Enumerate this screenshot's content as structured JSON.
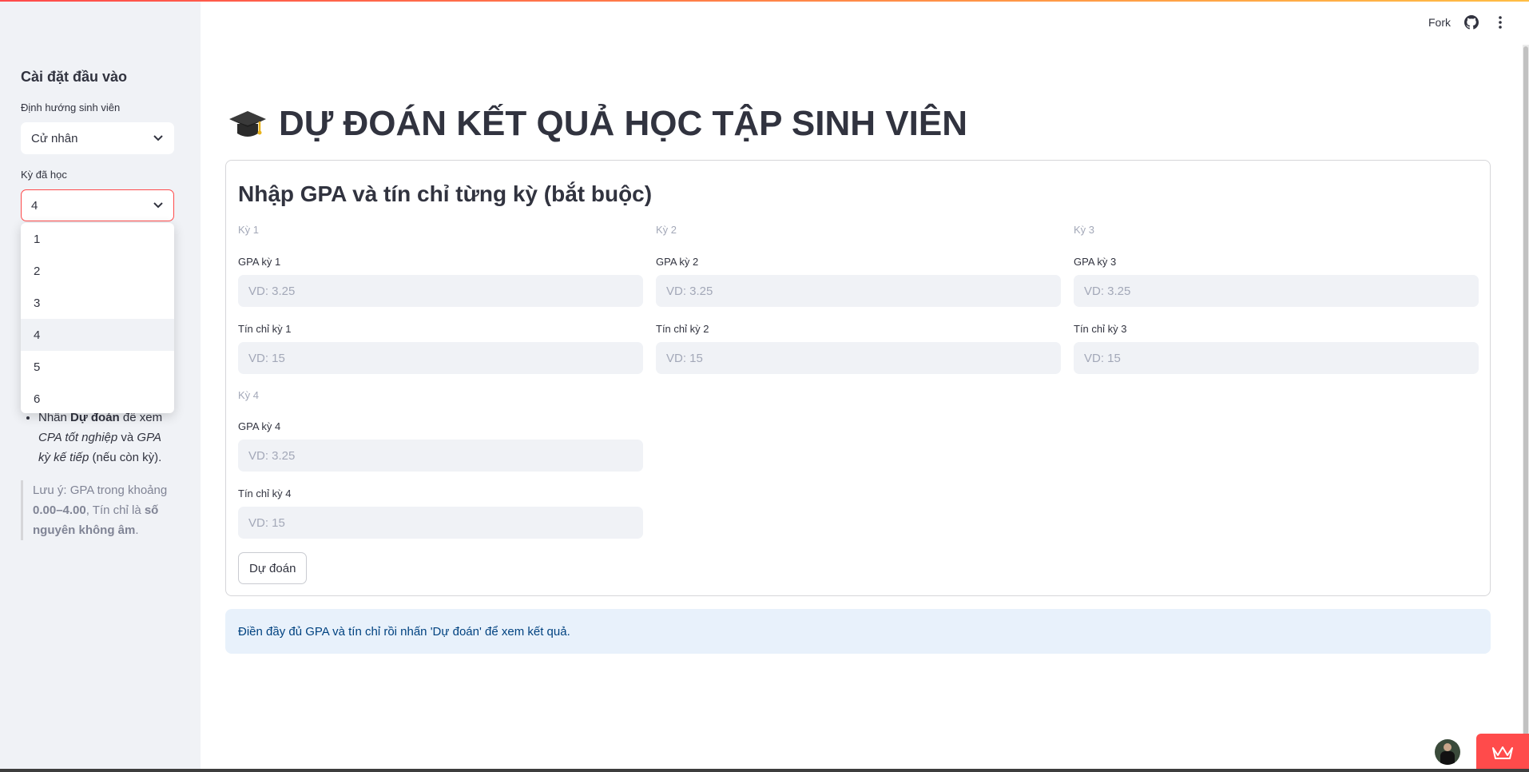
{
  "sidebar": {
    "title": "Cài đặt đầu vào",
    "orientation_label": "Định hướng sinh viên",
    "orientation_value": "Cử nhân",
    "semesters_label": "Kỳ đã học",
    "semesters_value": "4",
    "dropdown_options": [
      "1",
      "2",
      "3",
      "4",
      "5",
      "6"
    ],
    "dropdown_selected": "4",
    "instruction": {
      "prefix": "Nhấn ",
      "button_name": "Dự đoán",
      "middle": " để xem ",
      "item1": "CPA tốt nghiệp",
      "and": " và ",
      "item2": "GPA kỳ kế tiếp",
      "suffix": " (nếu còn kỳ)."
    },
    "note": {
      "prefix": "Lưu ý: GPA trong khoảng ",
      "range": "0.00–4.00",
      "middle": ", Tín chỉ là ",
      "rule": "số nguyên không âm",
      "suffix": "."
    }
  },
  "header": {
    "fork_label": "Fork",
    "icons": [
      "github-icon",
      "more-vertical-icon"
    ]
  },
  "main": {
    "title": "DỰ ĐOÁN KẾT QUẢ HỌC TẬP SINH VIÊN",
    "title_icon": "graduation-cap-icon",
    "form": {
      "title": "Nhập GPA và tín chỉ từng kỳ (bắt buộc)",
      "semesters": [
        {
          "caption": "Kỳ 1",
          "gpa_label": "GPA kỳ 1",
          "gpa_placeholder": "VD: 3.25",
          "credit_label": "Tín chỉ kỳ 1",
          "credit_placeholder": "VD: 15"
        },
        {
          "caption": "Kỳ 2",
          "gpa_label": "GPA kỳ 2",
          "gpa_placeholder": "VD: 3.25",
          "credit_label": "Tín chỉ kỳ 2",
          "credit_placeholder": "VD: 15"
        },
        {
          "caption": "Kỳ 3",
          "gpa_label": "GPA kỳ 3",
          "gpa_placeholder": "VD: 3.25",
          "credit_label": "Tín chỉ kỳ 3",
          "credit_placeholder": "VD: 15"
        },
        {
          "caption": "Kỳ 4",
          "gpa_label": "GPA kỳ 4",
          "gpa_placeholder": "VD: 3.25",
          "credit_label": "Tín chỉ kỳ 4",
          "credit_placeholder": "VD: 15"
        }
      ],
      "submit_label": "Dự đoán"
    },
    "info_message": "Điền đầy đủ GPA và tín chỉ rồi nhấn 'Dự đoán' để xem kết quả."
  },
  "colors": {
    "accent": "#ff4b4b",
    "sidebar_bg": "#f0f2f6",
    "info_bg": "#e8f1fb",
    "info_text": "#004280"
  }
}
